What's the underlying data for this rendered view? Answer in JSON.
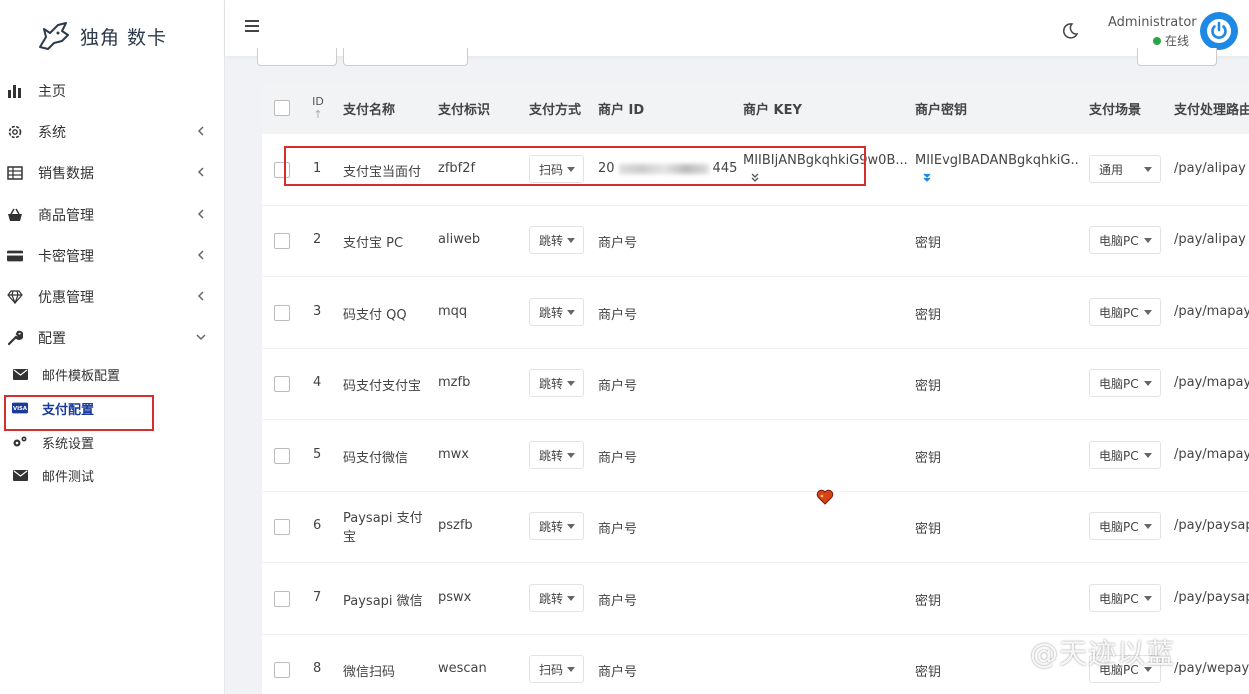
{
  "brand": {
    "title": "独角 数卡"
  },
  "sidebar": {
    "items": [
      {
        "label": "主页",
        "icon": "bar-chart-icon"
      },
      {
        "label": "系统",
        "icon": "gear-icon"
      },
      {
        "label": "销售数据",
        "icon": "table-icon"
      },
      {
        "label": "商品管理",
        "icon": "shopping-basket-icon"
      },
      {
        "label": "卡密管理",
        "icon": "credit-card-icon"
      },
      {
        "label": "优惠管理",
        "icon": "diamond-icon"
      },
      {
        "label": "配置",
        "icon": "wrench-icon"
      }
    ],
    "sub_items": [
      {
        "label": "邮件模板配置",
        "icon": "envelope-icon"
      },
      {
        "label": "支付配置",
        "icon": "visa-card-icon"
      },
      {
        "label": "系统设置",
        "icon": "cogs-icon"
      },
      {
        "label": "邮件测试",
        "icon": "envelope-icon"
      }
    ]
  },
  "header": {
    "user_name": "Administrator",
    "user_status": "在线"
  },
  "table": {
    "headers": {
      "id": "ID",
      "sort": "↑",
      "name": "支付名称",
      "tag": "支付标识",
      "method": "支付方式",
      "merchant_id": "商户 ID",
      "merchant_key": "商户 KEY",
      "merchant_secret": "商户密钥",
      "scene": "支付场景",
      "route": "支付处理路由"
    },
    "rows": [
      {
        "id": "1",
        "name": "支付宝当面付",
        "tag": "zfbf2f",
        "method": "扫码",
        "merchant_id_prefix": "20",
        "merchant_id_suffix": "445",
        "merchant_key": "MIIBIjANBgkqhkiG9w0B...",
        "merchant_secret": "MIIEvgIBADANBgkqhkiG...",
        "scene": "通用",
        "route": "/pay/alipay"
      },
      {
        "id": "2",
        "name": "支付宝 PC",
        "tag": "aliweb",
        "method": "跳转",
        "merchant_id": "商户号",
        "merchant_key": "",
        "merchant_secret": "密钥",
        "scene": "电脑PC",
        "route": "/pay/alipay"
      },
      {
        "id": "3",
        "name": "码支付 QQ",
        "tag": "mqq",
        "method": "跳转",
        "merchant_id": "商户号",
        "merchant_key": "",
        "merchant_secret": "密钥",
        "scene": "电脑PC",
        "route": "/pay/mapay"
      },
      {
        "id": "4",
        "name": "码支付支付宝",
        "tag": "mzfb",
        "method": "跳转",
        "merchant_id": "商户号",
        "merchant_key": "",
        "merchant_secret": "密钥",
        "scene": "电脑PC",
        "route": "/pay/mapay"
      },
      {
        "id": "5",
        "name": "码支付微信",
        "tag": "mwx",
        "method": "跳转",
        "merchant_id": "商户号",
        "merchant_key": "",
        "merchant_secret": "密钥",
        "scene": "电脑PC",
        "route": "/pay/mapay"
      },
      {
        "id": "6",
        "name": "Paysapi 支付",
        "name2": "宝",
        "tag": "pszfb",
        "method": "跳转",
        "merchant_id": "商户号",
        "merchant_key": "",
        "merchant_secret": "密钥",
        "scene": "电脑PC",
        "route": "/pay/paysapi"
      },
      {
        "id": "7",
        "name": "Paysapi 微信",
        "tag": "pswx",
        "method": "跳转",
        "merchant_id": "商户号",
        "merchant_key": "",
        "merchant_secret": "密钥",
        "scene": "电脑PC",
        "route": "/pay/paysapi"
      },
      {
        "id": "8",
        "name": "微信扫码",
        "tag": "wescan",
        "method": "扫码",
        "merchant_id": "商户号",
        "merchant_key": "",
        "merchant_secret": "密钥",
        "scene": "电脑PC",
        "route": "/pay/wepay"
      }
    ]
  },
  "watermark": "@天迹以蓝",
  "colors": {
    "accent": "#1e88e5",
    "highlight_box": "#d32f2f",
    "online": "#28a745"
  }
}
